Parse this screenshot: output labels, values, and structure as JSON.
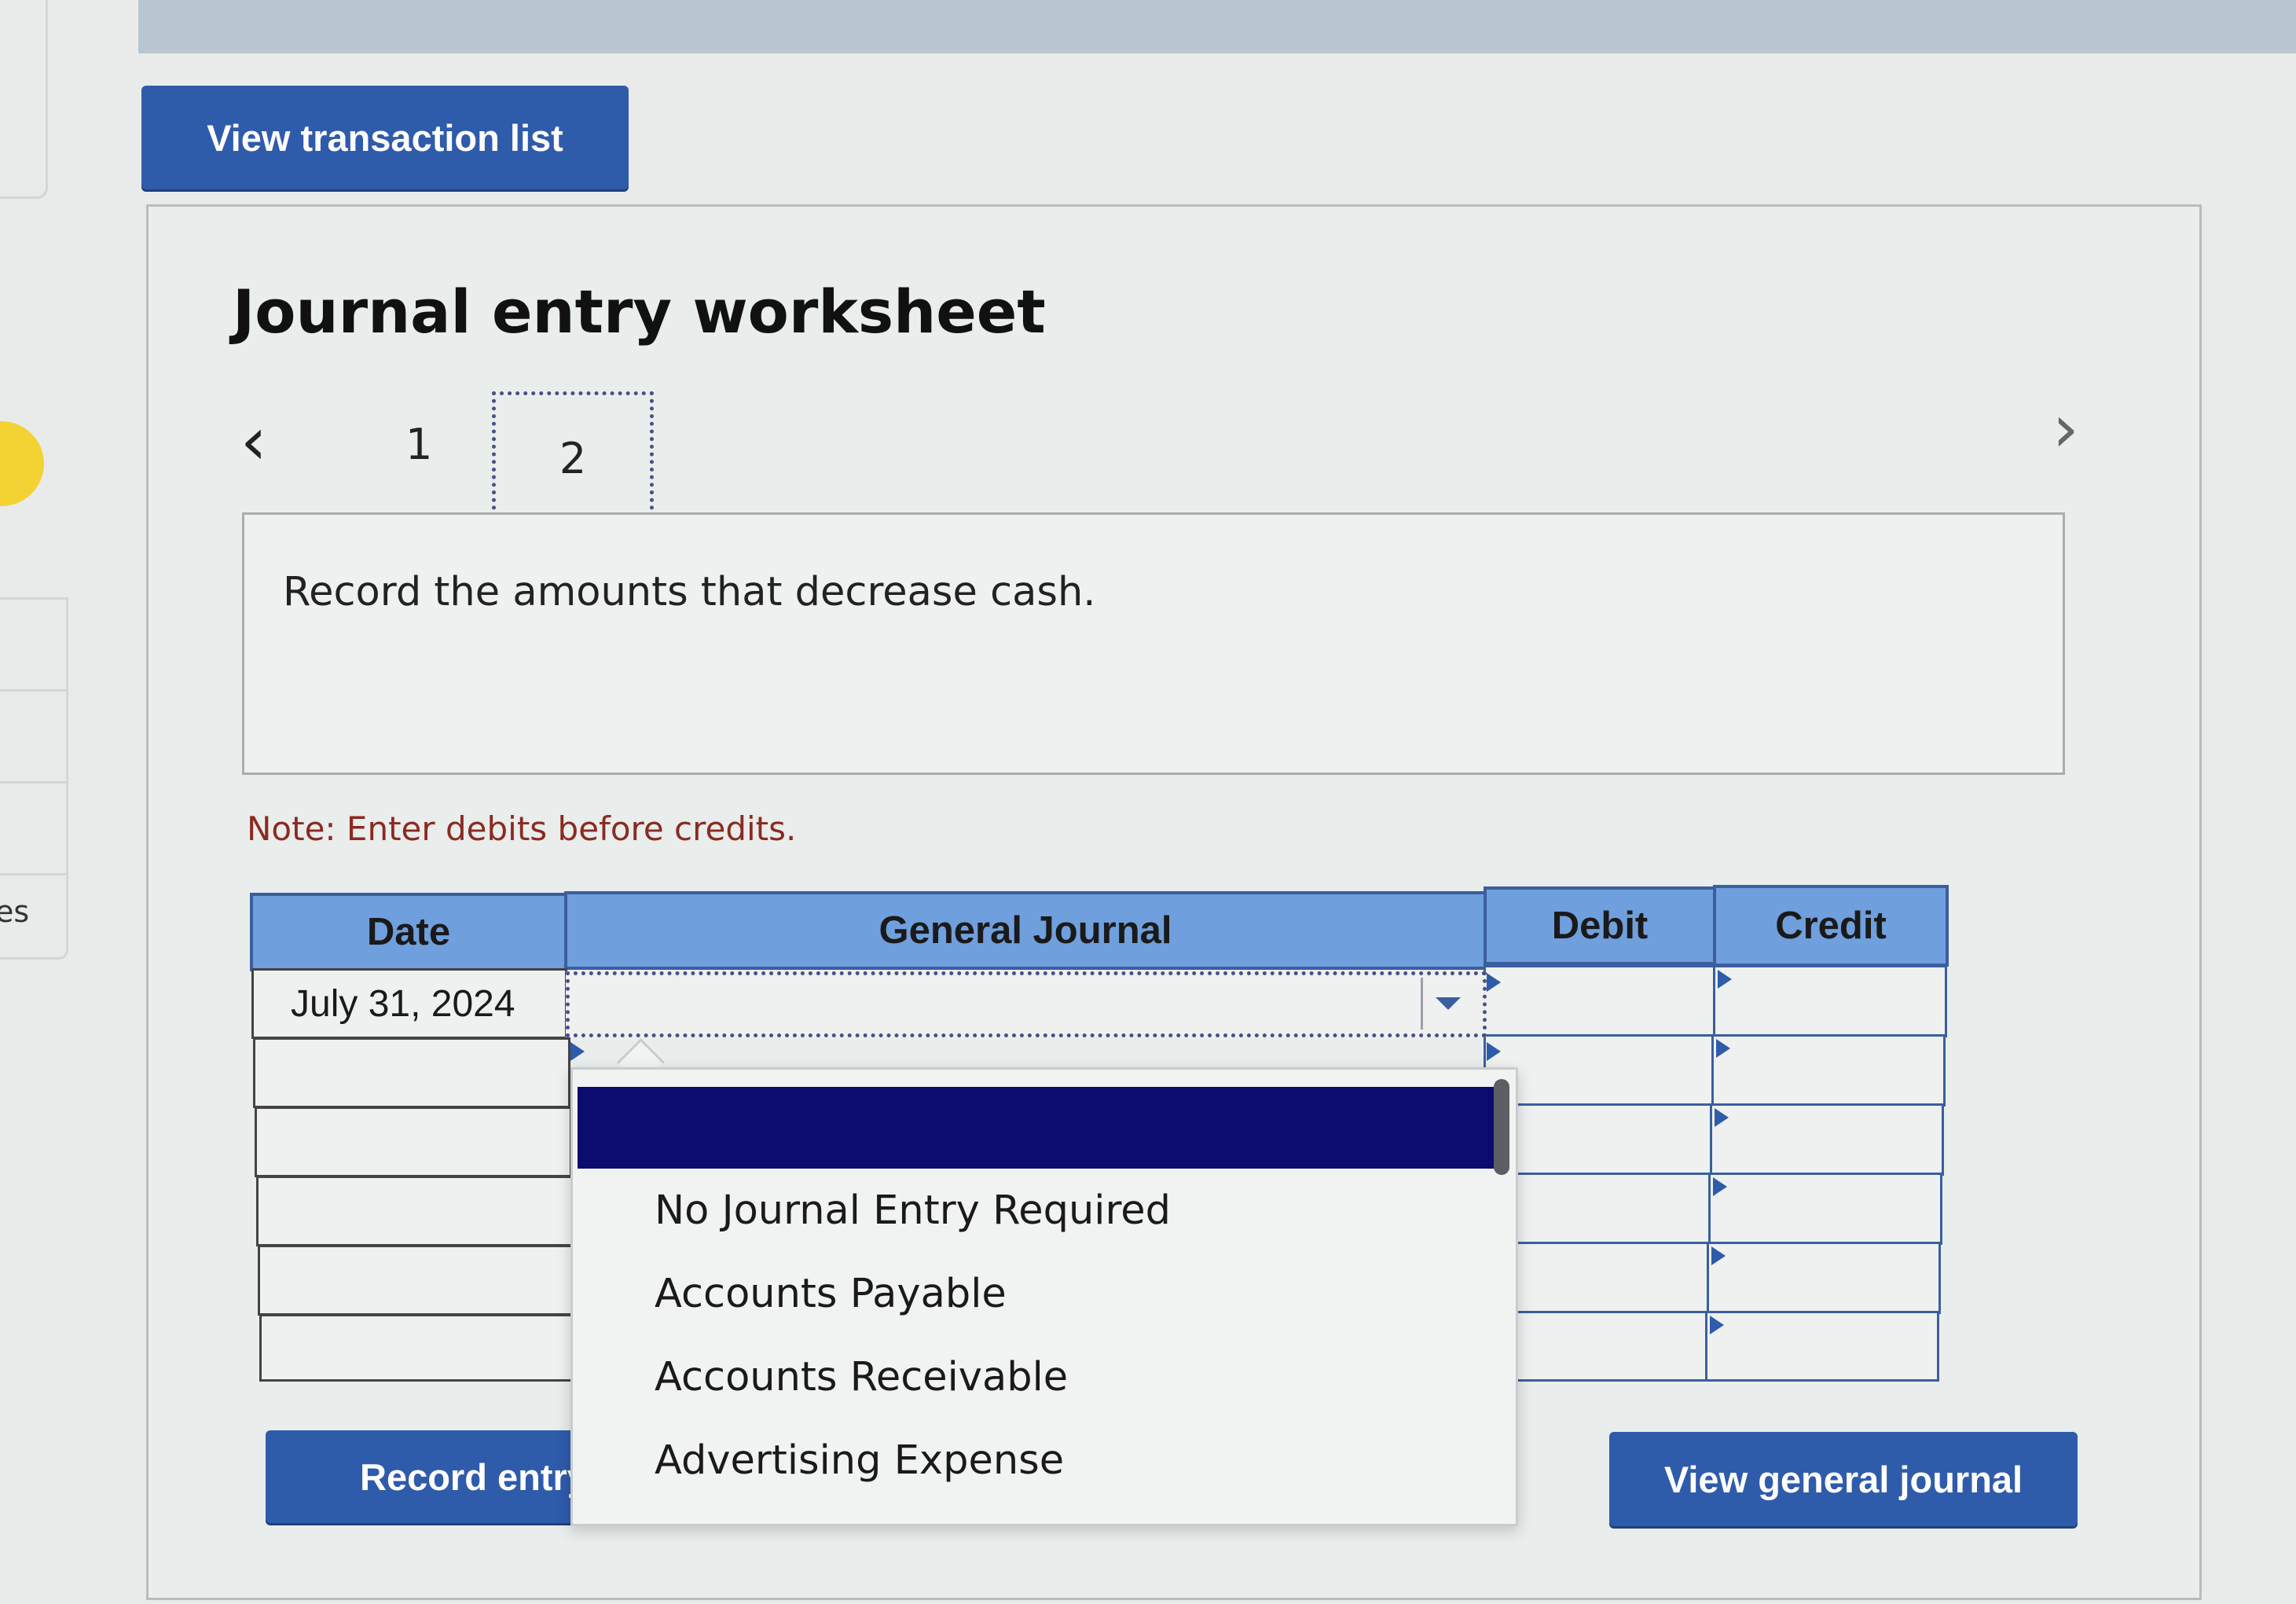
{
  "sidebar": {
    "partial_label": "es"
  },
  "toolbar": {
    "view_transaction_list": "View transaction list"
  },
  "worksheet": {
    "title": "Journal entry worksheet",
    "pages": [
      "1",
      "2"
    ],
    "active_page": "2",
    "prev_icon": "chevron-left-icon",
    "next_icon": "chevron-right-icon",
    "instruction": "Record the amounts that decrease cash.",
    "note": "Note: Enter debits before credits."
  },
  "table": {
    "headers": {
      "date": "Date",
      "general_journal": "General Journal",
      "debit": "Debit",
      "credit": "Credit"
    },
    "rows": [
      {
        "date": "July 31, 2024",
        "account": "",
        "debit": "",
        "credit": ""
      },
      {
        "date": "",
        "account": "",
        "debit": "",
        "credit": ""
      },
      {
        "date": "",
        "account": "",
        "debit": "",
        "credit": ""
      },
      {
        "date": "",
        "account": "",
        "debit": "",
        "credit": ""
      },
      {
        "date": "",
        "account": "",
        "debit": "",
        "credit": ""
      },
      {
        "date": "",
        "account": "",
        "debit": "",
        "credit": ""
      }
    ]
  },
  "dropdown": {
    "selected_value": "",
    "options": [
      "No Journal Entry Required",
      "Accounts Payable",
      "Accounts Receivable",
      "Advertising Expense"
    ]
  },
  "actions": {
    "record_entry": "Record entry",
    "view_general_journal": "View general journal"
  },
  "colors": {
    "button": "#2f5bab",
    "header": "#6f9fdc",
    "dropdown_highlight": "#0b0c6e",
    "note": "#8b2a20"
  }
}
